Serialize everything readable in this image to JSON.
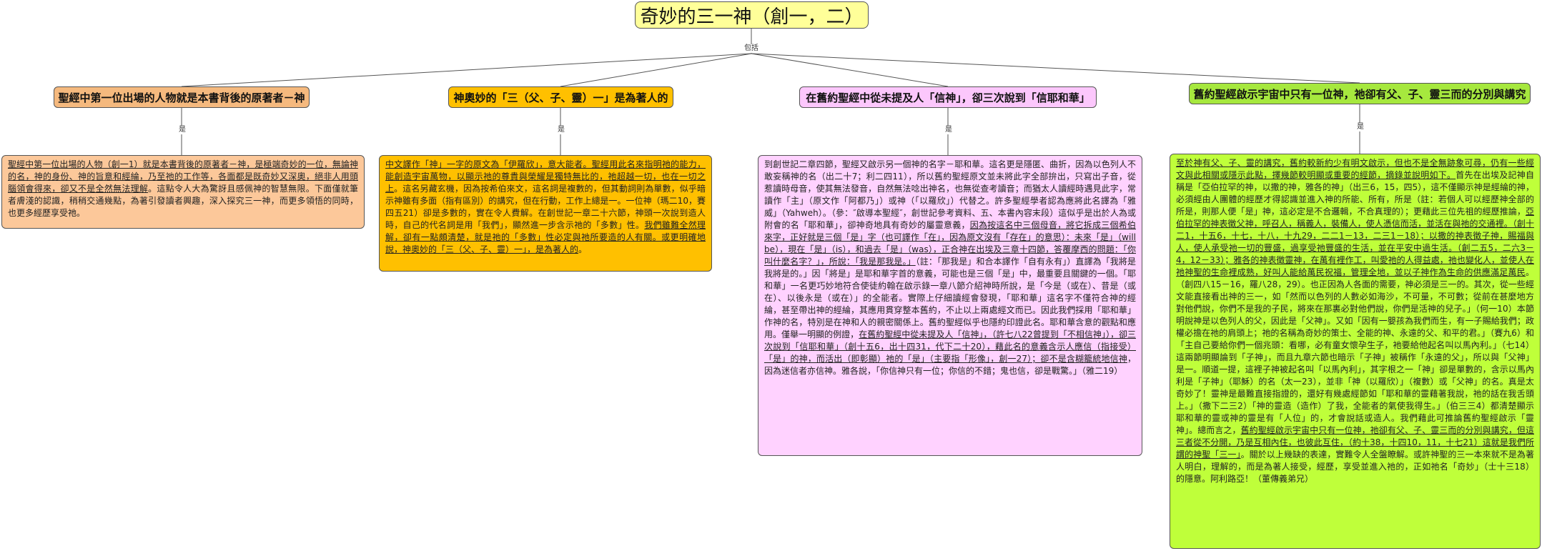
{
  "root": {
    "title": "奇妙的三一神（創一，二）"
  },
  "root_link_label": "包括",
  "branch_link_label": "是",
  "branches": [
    {
      "topic": "聖經中第一位出場的人物就是本書背後的原著者－神",
      "detail_a": "聖經中第一位出場的人物（創一1）就是本書背後的原著者－神，是極端奇妙的一位，無論神的名，神的身份、神的旨意和經綸，乃至祂的工作等，各面都是既奇妙又深奧，絕非人用頭腦領會得來，卻又不是全然無法理解",
      "detail_b": "。這點令人大為驚訝且感佩神的智慧無限。下面僅就筆者膚淺的認識，稍稍交通幾點，為著引發讀者興趣，深入探究三一神，而更多領悟的同時，也更多經歷享受祂。"
    },
    {
      "topic": "神奧妙的「三（父、子、靈）一」是為著人的",
      "detail_a": "中文譯作「神」一字的原文為「伊羅欣」，意大能者。聖經用此名來指明祂的能力，能創造宇宙萬物，以顯示祂的尊貴與榮耀是獨特無比的，祂超越一切，也在一切之上",
      "detail_b": "。這名另藏玄機，因為按希伯來文，這名詞是複數的，但其動詞則為單數，似乎暗示神雖有多面（指有區別）的講究，但在行動，工作上總是一。一位神（瑪二10，賽四五21）卻是多數的，實在令人費解。在創世記一章二十六節，神頭一次說到造人時，自己的代名詞是用「我們」，顯然進一步含示祂的「多數」性。",
      "detail_c": "我們雖難全然理解，卻有一點頗清楚，就是祂的「多數」性必定與祂所要造的人有關。或更明確地說，神奧妙的「三（父、子、靈）一」，是為著人的",
      "detail_d": "。"
    },
    {
      "topic": "在舊約聖經中從未提及人「信神」，卻三次說到「信耶和華」",
      "detail_a": "到創世記二章四節，聖經又啟示另一個神的名字－耶和華。這名更是隱匿、曲折，因為以色列人不敢妄稱神的名（出二十7；利二四11），所以舊約聖經原文並未將此字全部拚出，只寫出子音，從惹讀時母音，使其無法發音，自然無法唸出神名，也無從查考讀音；而猶太人讀經時遇見此字，常讀作「主」（原文作「阿都乃」）或神（「以羅欣」）代替之。許多聖經學者認為應將此名譯為「雅威」（Yahweh）。（參：″啟導本聖經″，創世記參考資料、五、本書內容末段）這似乎是出於人為或附會的名「耶和華」，卻神奇地具有奇妙的屬靈意義，",
      "detail_b": "因為按這名中三個母音，將它拆成三個希伯來字，正好就是三個「是」字（也可譯作「在」，因為原文沒有「存在」的意思）：未來「是」（will be），現在「是」（is），和過去「是」（was），正合神在出埃及三章十四節，答覆摩西的問題：「你叫什麼名字？」，所說：「我是那我是。」",
      "detail_c": "（註：「那我是」和合本譯作「自有永有」）直譯為「我將是我將是的。」因「將是」是耶和華字首的意義，可能也是三個「是」中，最重要且關鍵的一個。「耶和華」一名更巧妙地符合使徒約翰在啟示錄一章八節介紹神時所說，是「今是（或在）、昔是（或在）、以後永是（或在）」的全能者。實際上仔細讀經會發現，「耶和華」這名字不僅符合神的經綸，甚至帶出神的經綸，其應用貫穿整本舊約，不止以上兩處經文而已。因此我們採用「耶和華」作神的名，特別是在神和人的親密關係上。舊約聖經似乎也隱約印證此名。耶和華含意的觀點和應用。僅舉一明顯的例證，",
      "detail_d": "在舊約聖經中從未提及人「信神」，（許七八22曾提到「不相信神」），卻三次說到「信耶和華」（創十五6，出十四31，代下二十20），藉此名的意義含示人應信（指接受）「是」的神，而活出（即彰顯）祂的「是」（主要指「形像」，創一27）；卻不是含糊籠統地信神",
      "detail_e": "，因為迷信者亦信神。雅各說，「你信神只有一位；你信的不錯；鬼也信，卻是戰驚。」（雅二19）"
    },
    {
      "topic": "舊約聖經啟示宇宙中只有一位神，祂卻有父、子、靈三而的分別與講究",
      "detail_a": "至於神有父、子、靈的講究，舊約較新約少有明文啟示，但也不是全無跡象可尋，仍有一些經文與此相關或隱示此點，擇幾節較明顯或重要的經節，摘錄並說明如下。",
      "detail_b": "首先在出埃及記神自稱是「亞伯拉罕的神，以撒的神，雅各的神」（出三6，15，四5），這不僅顯示神是經綸的神，必須經由人團體的經歷才得認識並進入神的所能、所有，所是（註：若個人可以經歷神全部的所是，則那人便「是」神，這必定是不合邏輯，不合真理的）；更藉此三位先祖的經歷推論，",
      "detail_c": "亞伯拉罕的神表徵父神，呼召人，稱義人，裝備人，使人憑信而活，並活在與祂的交通裡。（創十二1，十五6，十七，十八，十九29，二二1－13，二三1－18）；以撒的神表徵子神，賜福與人，使人承受祂一切的豐盛，過享受祂豐盛的生活，並在平安中過生活。（創二五5，二六3－4，12－33）；雅各的神表徵靈神，在萬有裡作工，叫愛祂的人得益處，祂也變化人，並使人在祂神聖的生命裡成熟，好叫人能給萬民祝福，管理全地，並以子神作為生命的供應滿足萬民",
      "detail_d": "。（創四八15－16，羅八28，29）。也正因為人各面的需要，神必須是三一的。其次，從一些經文能直接看出神的三一，如「然而以色列的人數必如海沙，不可量，不可數；從前在甚麼地方對他們說，你們不是我的子民，將來在那裏必對他們說，你們是活神的兒子。」（何一10）本節明說神是以色列人的父，因此是「父神」。又如「因有一嬰孩為我們而生，有一子賜給我們；政權必擔在祂的肩頭上；祂的名稱為奇妙的策士、全能的神、永遠的父、和平的君。」（賽九6）和「主自己要給你們一個兆頭：看哪，必有童女懷孕生子，衪要給他起名叫以馬內利。」（七14）這兩節明顯論到「子神」，而且九章六節也暗示「子神」被稱作「永遠的父」，所以與「父神」是一。順道一提，這裡子神被起名叫「以馬內利」，其字根之一「神」卻是單數的，含示以馬內利是「子神」（耶穌）的名（太一23），並非「神（以羅欣）」（複數）或「父神」的名。真是太奇妙了！靈神是最難直接指證的，還好有幾處經節如「耶和華的靈藉著我說，祂的話在我舌頭上。」（撒下二三2）「神的靈造（造作）了我，全能者的氣使我得生。」（伯三三4）都清楚顯示耶和華的靈或神的靈是有「人位」的，才會說話或造人。我們藉此可推論舊約聖經啟示「靈神」。總而言之，",
      "detail_e": "舊約聖經啟示宇宙中只有一位神，祂卻有父、子、靈三而的分別與講究，但這三者從不分開，乃是互相內住，也彼此互住，（約十38，十四10，11，十七21）這就是我們所謂的神聖「三一」",
      "detail_f": "。關於以上幾缺的表達，實難令人全盤瞭解。或許神聖的三一本來就不是為著人明白，理解的，而是為著人接受，經歷，享受並進入祂的，正如祂名「奇妙」（士十三18）的隱意。阿利路亞！（董傳義弟兄）"
    }
  ]
}
